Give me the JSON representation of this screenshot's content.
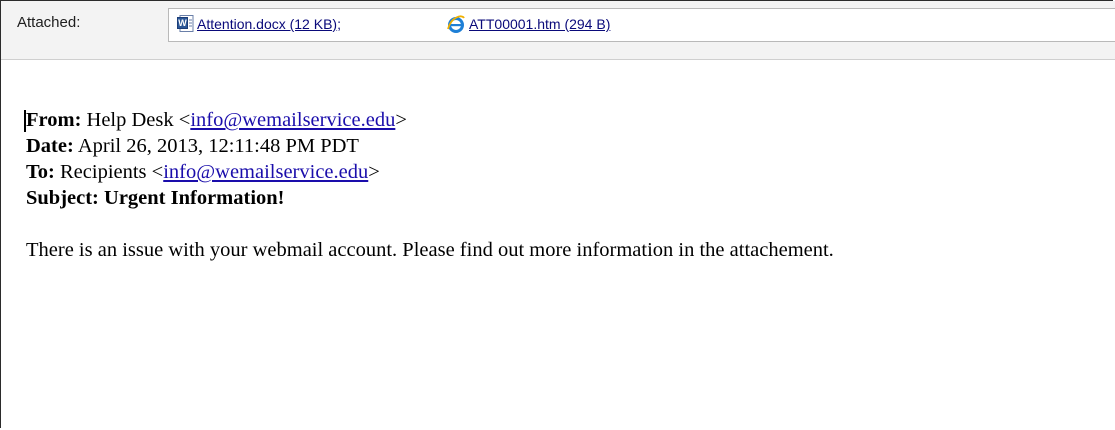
{
  "attachments_bar": {
    "label": "Attached:",
    "files": [
      {
        "name": "Attention.docx (12 KB)",
        "icon": "word-doc-icon"
      },
      {
        "name": "ATT00001.htm (294 B)",
        "icon": "internet-explorer-icon"
      }
    ],
    "separator": ";"
  },
  "message": {
    "from_label": "From:",
    "from_name": "Help Desk <",
    "from_email": "info@wemailservice.edu",
    "from_close": ">",
    "date_label": "Date:",
    "date_value": "April 26, 2013, 12:11:48 PM PDT",
    "to_label": "To:",
    "to_name": "Recipients <",
    "to_email": "info@wemailservice.edu",
    "to_close": ">",
    "subject_label": "Subject:",
    "subject_value": "Urgent Information!",
    "body_text": "There is an issue with your webmail account. Please find out more information in the attachement."
  },
  "colors": {
    "link": "#1a0dab",
    "attachment_link": "#0a0a7a",
    "bar_bg": "#f3f3f3"
  }
}
